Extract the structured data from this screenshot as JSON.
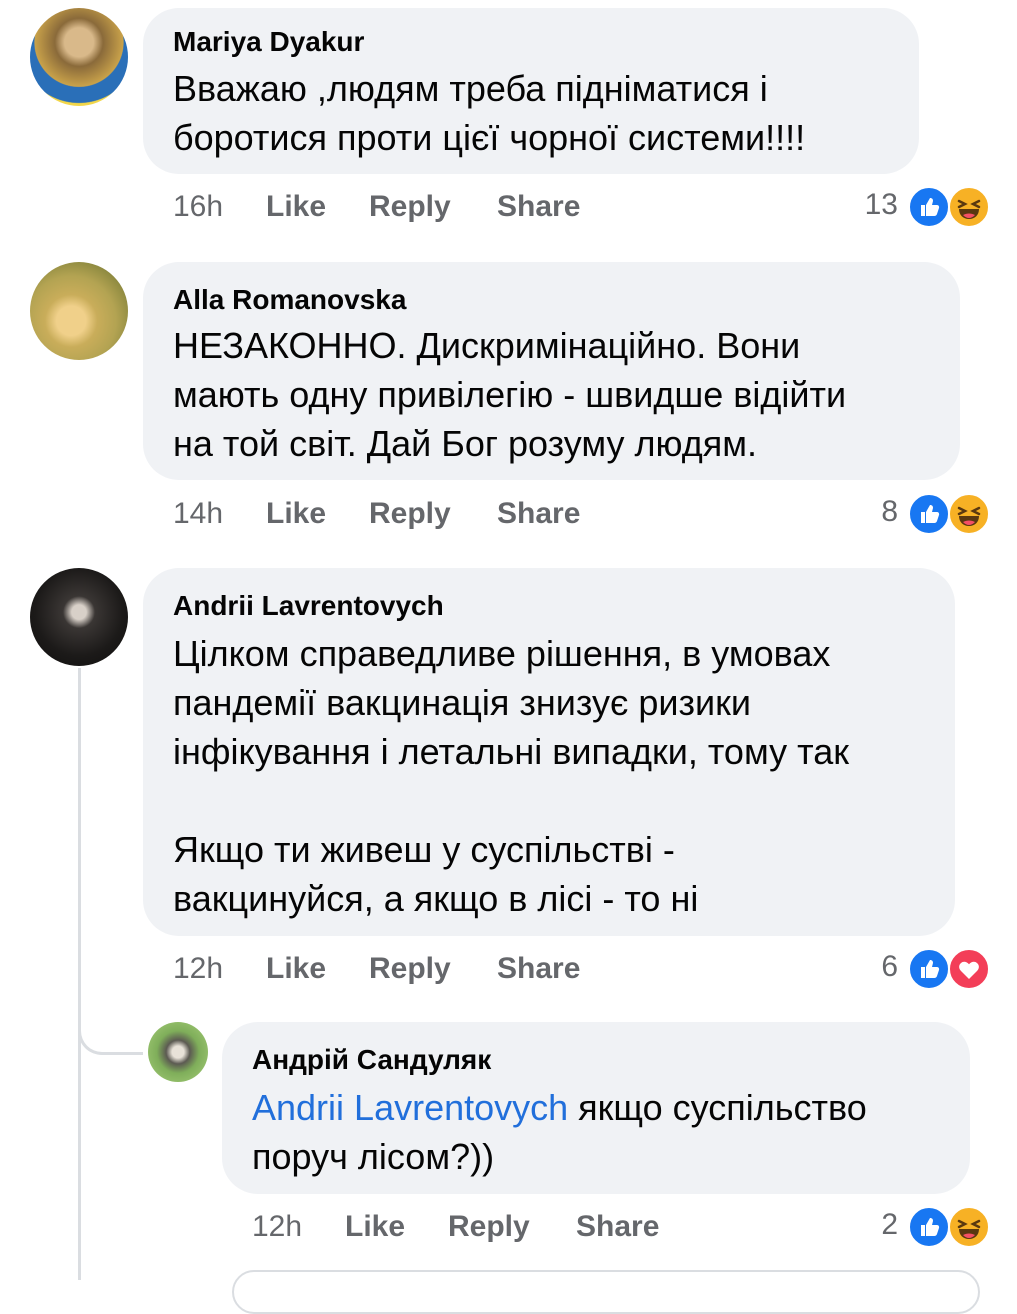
{
  "colors": {
    "bubble": "#f0f2f5",
    "meta_text": "#65676b",
    "mention": "#216fdb",
    "like_blue": "#1877f2",
    "love_red": "#f33e58",
    "haha_yellow": "#f7b125"
  },
  "comments": [
    {
      "author": "Mariya Dyakur",
      "text": "Вважаю ,людям треба підніматися і\nборотися проти цієї чорної системи!!!!",
      "time": "16h",
      "like": "Like",
      "reply": "Reply",
      "share": "Share",
      "reaction_count": "13",
      "reactions": [
        "like-icon",
        "haha-icon"
      ]
    },
    {
      "author": "Alla Romanovska",
      "text": "НЕЗАКОННО.  Дискримінаційно. Вони\nмають одну привілегію - швидше відійти\nна той світ. Дай Бог розуму людям.",
      "time": "14h",
      "like": "Like",
      "reply": "Reply",
      "share": "Share",
      "reaction_count": "8",
      "reactions": [
        "like-icon",
        "haha-icon"
      ]
    },
    {
      "author": "Andrii Lavrentovych",
      "text": "Цілком справедливе рішення, в умовах\nпандемії вакцинація знизує ризики\nінфікування і летальні випадки, тому так\n\nЯкщо ти живеш у суспільстві -\nвакцинуйся, а якщо в лісі - то ні",
      "time": "12h",
      "like": "Like",
      "reply": "Reply",
      "share": "Share",
      "reaction_count": "6",
      "reactions": [
        "like-icon",
        "love-icon"
      ]
    }
  ],
  "reply": {
    "author": "Андрій Сандуляк",
    "mention": "Andrii Lavrentovych",
    "text_line1": " якщо суспільство",
    "text_line2": "поруч  лісом?))",
    "time": "12h",
    "like": "Like",
    "reply": "Reply",
    "share": "Share",
    "reaction_count": "2",
    "reactions": [
      "like-icon",
      "haha-icon"
    ]
  }
}
